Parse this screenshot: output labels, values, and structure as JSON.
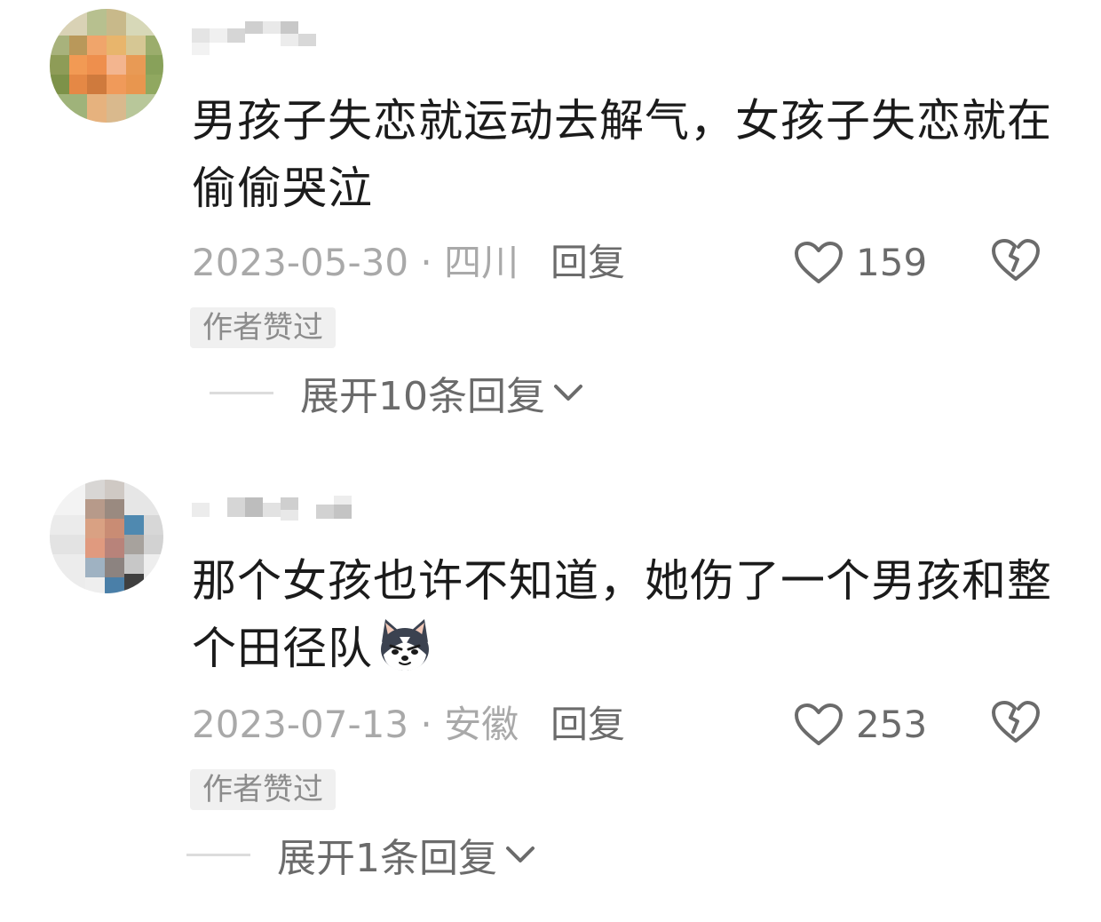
{
  "comments": [
    {
      "text": "男孩子失恋就运动去解气，女孩子失恋就在偷偷哭泣",
      "date_location": "2023-05-30 · 四川",
      "reply_label": "回复",
      "like_count": "159",
      "badge": "作者赞过",
      "expand_label": "展开10条回复",
      "icons": [
        "heart-outline-icon",
        "broken-heart-icon",
        "chevron-down-icon"
      ]
    },
    {
      "text": "那个女孩也许不知道，她伤了一个男孩和整个田径队",
      "emoji": "husky-dog-emoji",
      "date_location": "2023-07-13 · 安徽",
      "reply_label": "回复",
      "like_count": "253",
      "badge": "作者赞过",
      "expand_label": "展开1条回复",
      "icons": [
        "heart-outline-icon",
        "broken-heart-icon",
        "chevron-down-icon"
      ]
    }
  ],
  "colors": {
    "text_primary": "#1b1b1b",
    "text_secondary": "#a9a9a9",
    "text_action": "#6b6b6b",
    "badge_bg": "#f0f0f0"
  }
}
